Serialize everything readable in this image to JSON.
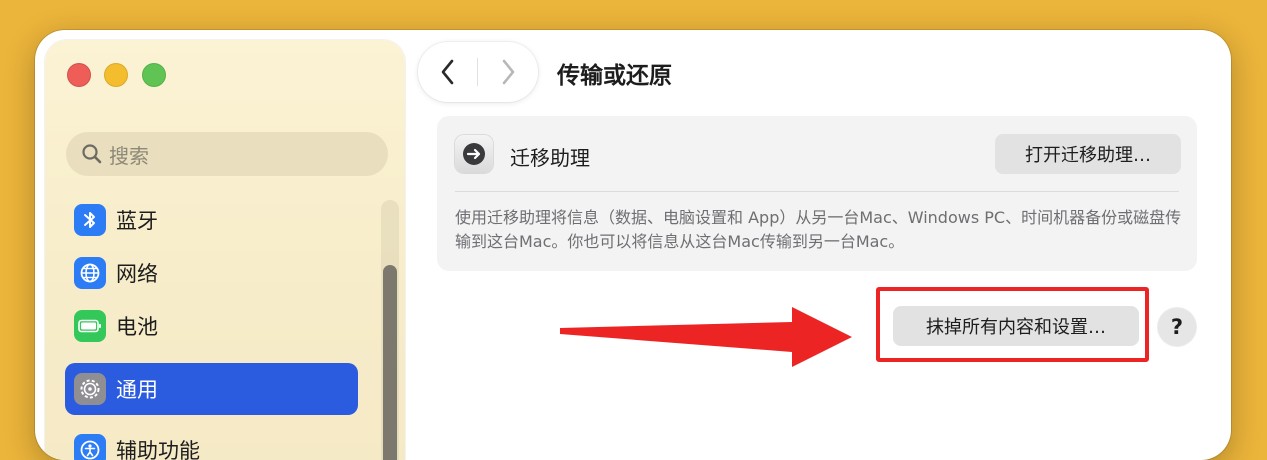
{
  "window": {
    "title": "传输或还原"
  },
  "sidebar": {
    "search_placeholder": "搜索",
    "items": [
      {
        "label": "蓝牙",
        "icon": "bluetooth-icon",
        "icon_color": "#2c7cf6"
      },
      {
        "label": "网络",
        "icon": "globe-icon",
        "icon_color": "#2c7cf6"
      },
      {
        "label": "电池",
        "icon": "battery-icon",
        "icon_color": "#34c759"
      },
      {
        "label": "通用",
        "icon": "gear-icon",
        "icon_color": "#8e8e93",
        "selected": true
      },
      {
        "label": "辅助功能",
        "icon": "accessibility-icon",
        "icon_color": "#2c7cf6"
      }
    ]
  },
  "nav": {
    "back_icon": "chevron-left-icon",
    "forward_icon": "chevron-right-icon"
  },
  "migration": {
    "icon": "migration-assistant-icon",
    "title": "迁移助理",
    "open_button": "打开迁移助理…",
    "description": "使用迁移助理将信息（数据、电脑设置和 App）从另一台Mac、Windows PC、时间机器备份或磁盘传输到这台Mac。你也可以将信息从这台Mac传输到另一台Mac。"
  },
  "erase": {
    "button": "抹掉所有内容和设置…",
    "help": "?"
  },
  "colors": {
    "accent": "#2b5ce0",
    "annotation": "#ec2424",
    "background": "#ebb43a"
  }
}
